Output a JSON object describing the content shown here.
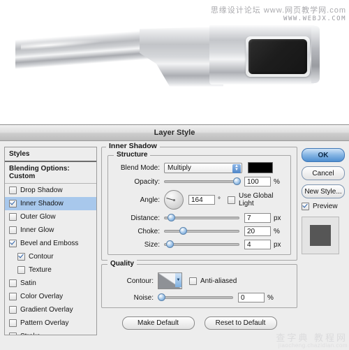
{
  "artwork": {
    "watermark_top_cn": "思缘设计论坛 www.网页教学网.com",
    "watermark_top_url": "WWW.WEBJX.COM",
    "watermark_bottom_cn": "查字典 教程网",
    "watermark_bottom_url": "jiaocheng.chazidian.com",
    "device_name": "metallic-device-illustration"
  },
  "dialog": {
    "title": "Layer Style",
    "styles_panel": {
      "header": "Styles",
      "blending_options": "Blending Options: Custom",
      "items": [
        {
          "label": "Drop Shadow",
          "checked": false,
          "selected": false,
          "indent": false
        },
        {
          "label": "Inner Shadow",
          "checked": true,
          "selected": true,
          "indent": false
        },
        {
          "label": "Outer Glow",
          "checked": false,
          "selected": false,
          "indent": false
        },
        {
          "label": "Inner Glow",
          "checked": false,
          "selected": false,
          "indent": false
        },
        {
          "label": "Bevel and Emboss",
          "checked": true,
          "selected": false,
          "indent": false
        },
        {
          "label": "Contour",
          "checked": true,
          "selected": false,
          "indent": true
        },
        {
          "label": "Texture",
          "checked": false,
          "selected": false,
          "indent": true
        },
        {
          "label": "Satin",
          "checked": false,
          "selected": false,
          "indent": false
        },
        {
          "label": "Color Overlay",
          "checked": false,
          "selected": false,
          "indent": false
        },
        {
          "label": "Gradient Overlay",
          "checked": false,
          "selected": false,
          "indent": false
        },
        {
          "label": "Pattern Overlay",
          "checked": false,
          "selected": false,
          "indent": false
        },
        {
          "label": "Stroke",
          "checked": false,
          "selected": false,
          "indent": false
        }
      ]
    },
    "inner_shadow": {
      "section_title": "Inner Shadow",
      "structure": {
        "legend": "Structure",
        "blend_mode_label": "Blend Mode:",
        "blend_mode_value": "Multiply",
        "color_swatch": "#000000",
        "opacity_label": "Opacity:",
        "opacity_value": "100",
        "opacity_unit": "%",
        "angle_label": "Angle:",
        "angle_value": "164",
        "angle_unit": "°",
        "use_global_light_label": "Use Global Light",
        "use_global_light_checked": false,
        "distance_label": "Distance:",
        "distance_value": "7",
        "distance_unit": "px",
        "choke_label": "Choke:",
        "choke_value": "20",
        "choke_unit": "%",
        "size_label": "Size:",
        "size_value": "4",
        "size_unit": "px"
      },
      "quality": {
        "legend": "Quality",
        "contour_label": "Contour:",
        "anti_aliased_label": "Anti-aliased",
        "anti_aliased_checked": false,
        "noise_label": "Noise:",
        "noise_value": "0",
        "noise_unit": "%"
      },
      "make_default": "Make Default",
      "reset_to_default": "Reset to Default"
    },
    "actions": {
      "ok": "OK",
      "cancel": "Cancel",
      "new_style": "New Style...",
      "preview_label": "Preview",
      "preview_checked": true
    }
  }
}
